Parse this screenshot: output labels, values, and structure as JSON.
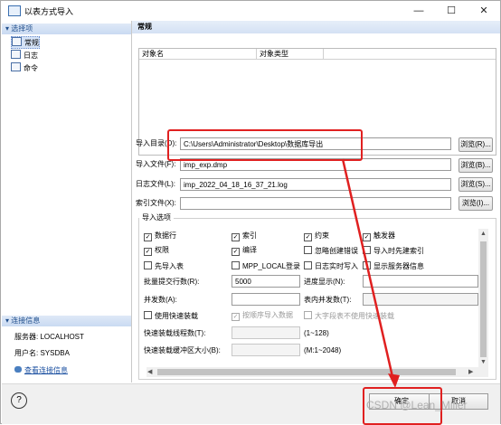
{
  "window": {
    "title": "以表方式导入",
    "min": "—",
    "max": "☐",
    "close": "✕"
  },
  "sidebar": {
    "options_header": "▾ 选择项",
    "items": [
      {
        "label": "常规"
      },
      {
        "label": "日志"
      },
      {
        "label": "命令"
      }
    ],
    "conn_header": "▾ 连接信息",
    "server": "服务器: LOCALHOST",
    "user": "用户名: SYSDBA",
    "view_link": "查看连接信息"
  },
  "main": {
    "header": "常规",
    "table_cols": [
      "对象名",
      "对象类型"
    ],
    "import_dir_label": "导入目录(D):",
    "import_dir_value": "C:\\Users\\Administrator\\Desktop\\数据库导出",
    "import_file_label": "导入文件(F):",
    "import_file_value": "imp_exp.dmp",
    "log_file_label": "日志文件(L):",
    "log_file_value": "imp_2022_04_18_16_37_21.log",
    "index_file_label": "索引文件(X):",
    "index_file_value": "",
    "browse_r": "浏览(R)...",
    "browse_b": "浏览(B)...",
    "browse_s": "浏览(S)...",
    "browse_i": "浏览(I)..."
  },
  "options": {
    "title": "导入选项",
    "cb": [
      {
        "label": "数据行",
        "checked": true
      },
      {
        "label": "索引",
        "checked": true
      },
      {
        "label": "约束",
        "checked": true
      },
      {
        "label": "触发器",
        "checked": true
      },
      {
        "label": "权限",
        "checked": true
      },
      {
        "label": "编译",
        "checked": true
      },
      {
        "label": "忽略创建错误",
        "checked": false
      },
      {
        "label": "导入时先建索引",
        "checked": false
      },
      {
        "label": "先导入表",
        "checked": false
      },
      {
        "label": "MPP_LOCAL登录",
        "checked": false
      },
      {
        "label": "日志实时写入",
        "checked": false
      },
      {
        "label": "显示服务器信息",
        "checked": false
      }
    ],
    "batch_label": "批量提交行数(R):",
    "batch_value": "5000",
    "progress_label": "进度显示(N):",
    "concurrency_label": "并发数(A):",
    "table_concurrency_label": "表内并发数(T):",
    "fast_load": "使用快速装载",
    "by_order": "按顺序导入数据",
    "case_sensitive": "大字段表不使用快速装载",
    "fast_threads_label": "快速装载线程数(T):",
    "fast_threads_hint": "(1~128)",
    "fast_buffer_label": "快速装载缓冲区大小(B):",
    "fast_buffer_hint": "(M:1~2048)"
  },
  "footer": {
    "help": "?",
    "ok": "确定",
    "cancel": "取消",
    "watermark": "CSDN @Lean_Miller"
  }
}
